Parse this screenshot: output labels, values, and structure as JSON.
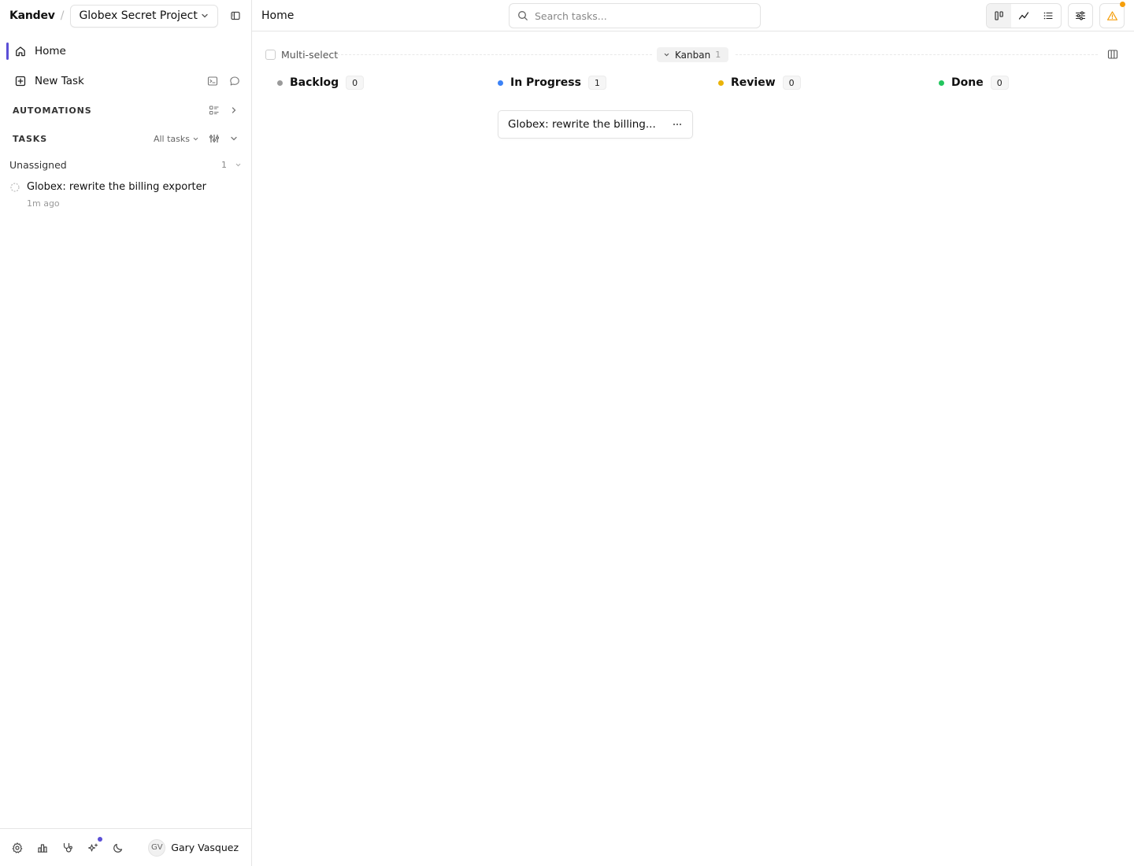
{
  "sidebar": {
    "brand": "Kandev",
    "separator": "/",
    "project": "Globex Secret Project",
    "nav": {
      "home": "Home",
      "new_task": "New Task"
    },
    "automations": {
      "title": "AUTOMATIONS"
    },
    "tasks": {
      "title": "TASKS",
      "filter": "All tasks",
      "groups": [
        {
          "name": "Unassigned",
          "count": "1",
          "items": [
            {
              "title": "Globex: rewrite the billing exporter",
              "time": "1m ago"
            }
          ]
        }
      ]
    },
    "user": {
      "initials": "GV",
      "name": "Gary Vasquez"
    }
  },
  "header": {
    "title": "Home",
    "search_placeholder": "Search tasks..."
  },
  "board": {
    "multiselect_label": "Multi-select",
    "view_label": "Kanban",
    "view_count": "1",
    "columns": [
      {
        "title": "Backlog",
        "count": "0",
        "color": "#9a9a9a"
      },
      {
        "title": "In Progress",
        "count": "1",
        "color": "#3b82f6"
      },
      {
        "title": "Review",
        "count": "0",
        "color": "#eab308"
      },
      {
        "title": "Done",
        "count": "0",
        "color": "#22c55e"
      }
    ],
    "cards": [
      {
        "title": "Globex: rewrite the billing..."
      }
    ]
  },
  "colors": {
    "accent": "#5b4fd6",
    "warning": "#f59e0b"
  }
}
